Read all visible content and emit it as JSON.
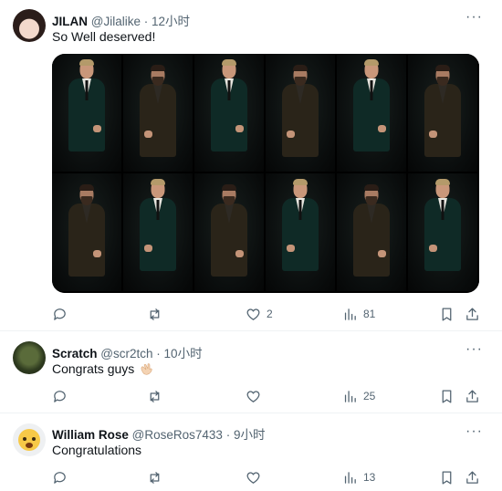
{
  "tweets": [
    {
      "name": "JILAN",
      "handle": "@Jilalike",
      "separator": "·",
      "time": "12小时",
      "text": "So Well deserved!",
      "replies": "",
      "retweets": "",
      "likes": "2",
      "views": "81"
    },
    {
      "name": "Scratch",
      "handle": "@scr2tch",
      "separator": "·",
      "time": "10小时",
      "text": "Congrats guys",
      "emoji": "clapping-hands",
      "replies": "",
      "retweets": "",
      "likes": "",
      "views": "25"
    },
    {
      "name": "William Rose",
      "handle": "@RoseRos7433",
      "separator": "·",
      "time": "9小时",
      "text": "Congratulations",
      "replies": "",
      "retweets": "",
      "likes": "",
      "views": "13"
    }
  ],
  "icons": {
    "more": "ellipsis-icon",
    "reply": "reply-icon",
    "retweet": "retweet-icon",
    "like": "heart-icon",
    "views": "views-icon",
    "bookmark": "bookmark-icon",
    "share": "share-icon"
  },
  "colors": {
    "text": "#0f1419",
    "secondary": "#536471",
    "divider": "#eff3f4"
  }
}
